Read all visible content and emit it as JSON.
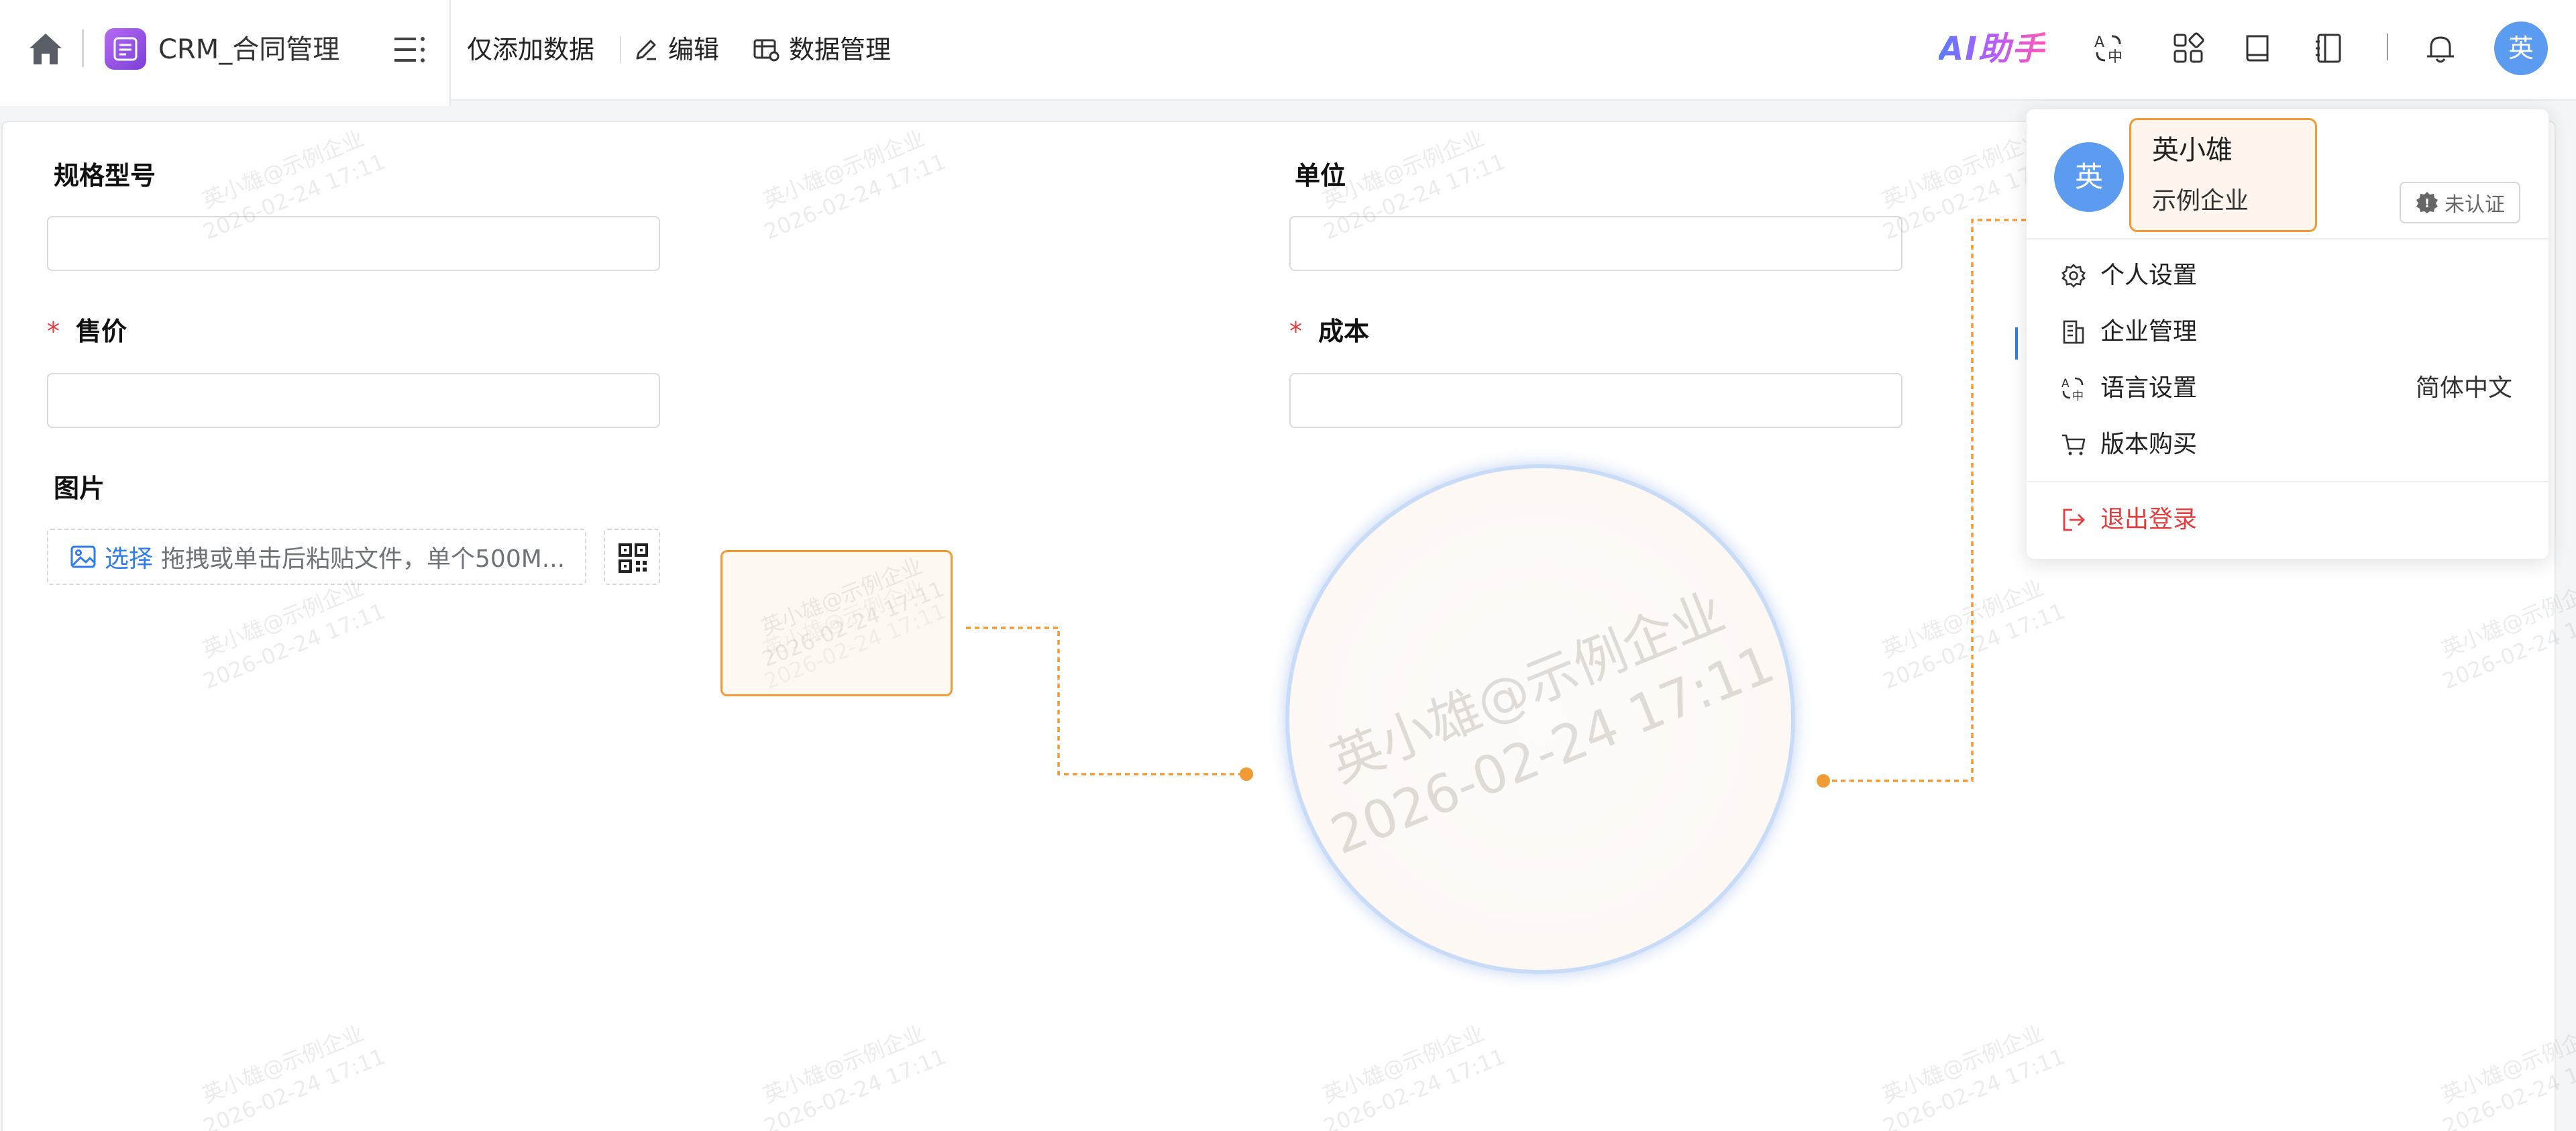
{
  "app": {
    "title": "CRM_合同管理"
  },
  "toolbar": {
    "add_only_label": "仅添加数据",
    "edit_label": "编辑",
    "data_mgmt_label": "数据管理",
    "ai_label": "AI助手"
  },
  "user": {
    "avatar_char": "英",
    "name": "英小雄",
    "company": "示例企业",
    "badge": "未认证"
  },
  "menu": {
    "personal": "个人设置",
    "enterprise": "企业管理",
    "language": "语言设置",
    "language_value": "简体中文",
    "purchase": "版本购买",
    "logout": "退出登录"
  },
  "form": {
    "spec_label": "规格型号",
    "unit_label": "单位",
    "price_label": "售价",
    "cost_label": "成本",
    "required_mark": "*",
    "image_label": "图片",
    "upload_pick": "选择",
    "upload_hint": "拖拽或单击后粘贴文件，单个500M..."
  },
  "watermark": {
    "line1": "英小雄@示例企业",
    "line2": "2026-02-24 17:11"
  },
  "colors": {
    "accent": "#2f7ee8",
    "annotation": "#f29a33",
    "danger": "#e33d3d",
    "avatar": "#5b9cf0"
  }
}
